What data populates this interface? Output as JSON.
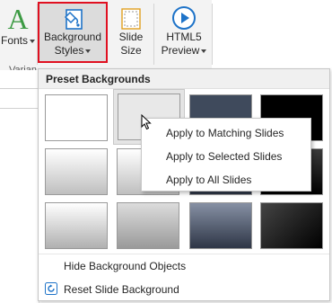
{
  "ribbon": {
    "fonts_label": "Fonts",
    "fonts_glyph": "A",
    "background_styles_line1": "Background",
    "background_styles_line2": "Styles",
    "slide_size_line1": "Slide",
    "slide_size_line2": "Size",
    "html5_line1": "HTML5",
    "html5_line2": "Preview",
    "group_label": "Varian"
  },
  "dropdown": {
    "header": "Preset Backgrounds",
    "hide_bg_objects": "Hide Background Objects",
    "reset_bg": "Reset Slide Background"
  },
  "context_menu": {
    "items": [
      "Apply to Matching Slides",
      "Apply to Selected Slides",
      "Apply to All Slides"
    ]
  },
  "colors": {
    "highlight_border": "#e01020",
    "fonts_green": "#3c9a43",
    "accent_blue": "#1e73c8"
  }
}
